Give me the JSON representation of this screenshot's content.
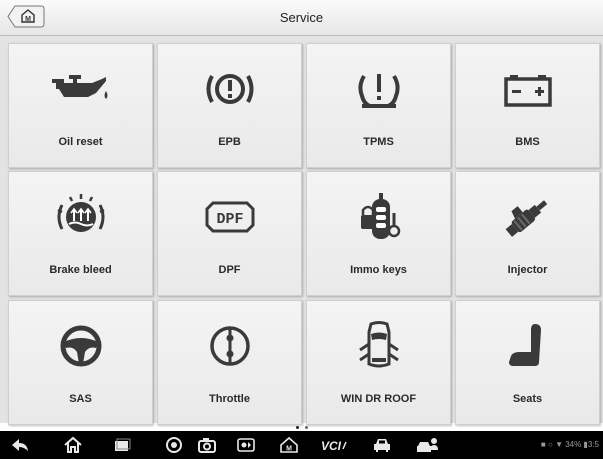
{
  "header": {
    "title": "Service"
  },
  "tiles": [
    {
      "label": "Oil reset",
      "icon": "oil-can-icon"
    },
    {
      "label": "EPB",
      "icon": "parking-brake-icon"
    },
    {
      "label": "TPMS",
      "icon": "tire-pressure-icon"
    },
    {
      "label": "BMS",
      "icon": "battery-icon"
    },
    {
      "label": "Brake bleed",
      "icon": "brake-bleed-icon"
    },
    {
      "label": "DPF",
      "icon": "dpf-icon"
    },
    {
      "label": "Immo keys",
      "icon": "immo-keys-icon"
    },
    {
      "label": "Injector",
      "icon": "injector-icon"
    },
    {
      "label": "SAS",
      "icon": "steering-wheel-icon"
    },
    {
      "label": "Throttle",
      "icon": "throttle-icon"
    },
    {
      "label": "WIN DR ROOF",
      "icon": "car-doors-icon"
    },
    {
      "label": "Seats",
      "icon": "seat-icon"
    }
  ],
  "dpf_icon_text": "DPF",
  "navbar": {
    "icons": [
      "back-icon",
      "home-icon",
      "recent-apps-icon",
      "browser-icon",
      "camera-icon",
      "screen-capture-icon",
      "maxisys-home-icon",
      "vci-icon",
      "car-icon",
      "user-car-icon"
    ],
    "vci_label": "VCI",
    "status_text": "34%",
    "clock": "3:5"
  }
}
